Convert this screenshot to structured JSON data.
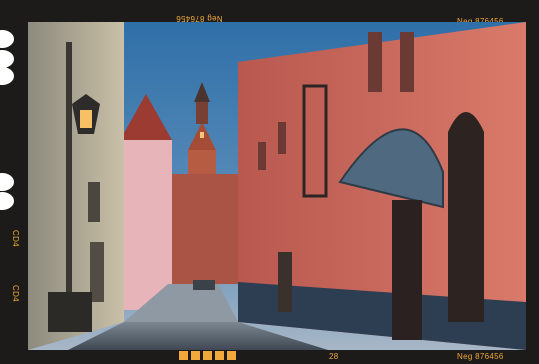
{
  "film": {
    "top_left_code": "Neg 876456",
    "top_right_code": "Neg 876456",
    "bottom_right_code": "Neg 876456",
    "frame_number": "28",
    "side_label_upper": "CD4",
    "side_label_lower": "CD4",
    "sprocket_block_count": 5,
    "accent_color": "#f0a93a",
    "border_color": "#1c1b1a"
  },
  "photo": {
    "subject": "old town street with pink buildings and clock tower at dusk"
  }
}
